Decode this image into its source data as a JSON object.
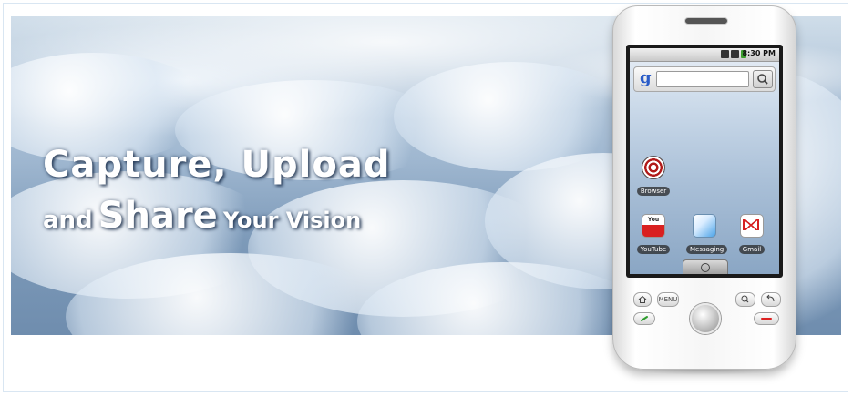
{
  "banner": {
    "line1": "Capture, Upload",
    "line2_and": "and",
    "line2_share": "Share",
    "line2_vision": "Your Vision"
  },
  "phone": {
    "status_time": "8:30 PM",
    "search_logo": "g",
    "apps": [
      {
        "label": "Browser",
        "icon": "browser-icon"
      },
      {
        "label": "YouTube",
        "icon": "youtube-icon"
      },
      {
        "label": "Messaging",
        "icon": "messaging-icon"
      },
      {
        "label": "Gmail",
        "icon": "gmail-icon"
      }
    ],
    "youtube_icon_text": "You",
    "menu_button_label": "MENU"
  },
  "colors": {
    "banner_text": "#ffffff",
    "frame_border": "#d9e6f2",
    "google_blue": "#2a5cc8"
  }
}
